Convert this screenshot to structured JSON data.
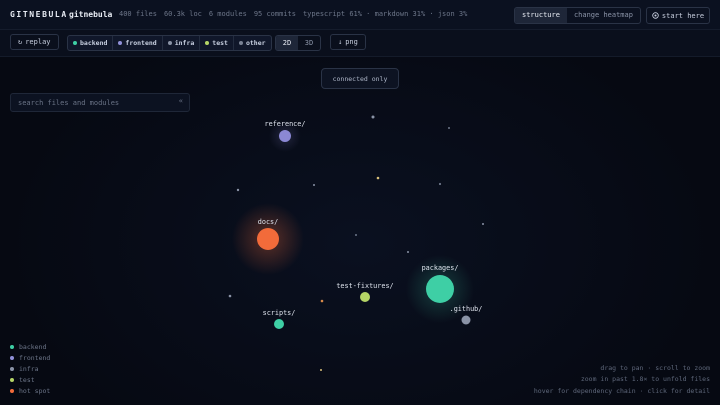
{
  "app": {
    "brand": "GITNEBULA",
    "repo": "gitnebula",
    "stats": [
      "400 files",
      "60.3k loc",
      "6 modules",
      "95 commits",
      "typescript 61% · markdown 31% · json 3%"
    ]
  },
  "view_toggle": {
    "structure": "structure",
    "heatmap": "change heatmap",
    "active": "structure"
  },
  "start_here": {
    "icon": "target-icon",
    "label": "start here"
  },
  "replay": {
    "icon": "replay-icon",
    "label": "replay"
  },
  "filters": [
    {
      "label": "backend",
      "color": "#3ecfa5"
    },
    {
      "label": "frontend",
      "color": "#9090d8"
    },
    {
      "label": "infra",
      "color": "#8a93a6"
    },
    {
      "label": "test",
      "color": "#b5d566"
    },
    {
      "label": "other",
      "color": "#7a8294"
    }
  ],
  "dimension": {
    "two_d": "2D",
    "three_d": "3D",
    "active": "2D"
  },
  "export_png": {
    "icon": "download-icon",
    "label": "png"
  },
  "toast": "connected only",
  "search": {
    "placeholder": "search files and modules",
    "value": "",
    "collapse_label": "«"
  },
  "graph": {
    "nodes": [
      {
        "label": "reference/",
        "color": "#8b88d4"
      },
      {
        "label": "docs/",
        "color": "#f26b3a"
      },
      {
        "label": "packages/",
        "color": "#3ecfa5"
      },
      {
        "label": "test-fixtures/",
        "color": "#b5d566"
      },
      {
        "label": "scripts/",
        "color": "#3ecfa5"
      },
      {
        "label": ".github/",
        "color": "#8a93a6"
      }
    ]
  },
  "legend": [
    {
      "label": "backend",
      "color": "#3ecfa5"
    },
    {
      "label": "frontend",
      "color": "#9090d8"
    },
    {
      "label": "infra",
      "color": "#8a93a6"
    },
    {
      "label": "test",
      "color": "#b5d566"
    },
    {
      "label": "hot spot",
      "color": "#f26b3a"
    }
  ],
  "hints": [
    "drag to pan · scroll to zoom",
    "zoom in past 1.8× to unfold files",
    "hover for dependency chain · click for detail"
  ]
}
